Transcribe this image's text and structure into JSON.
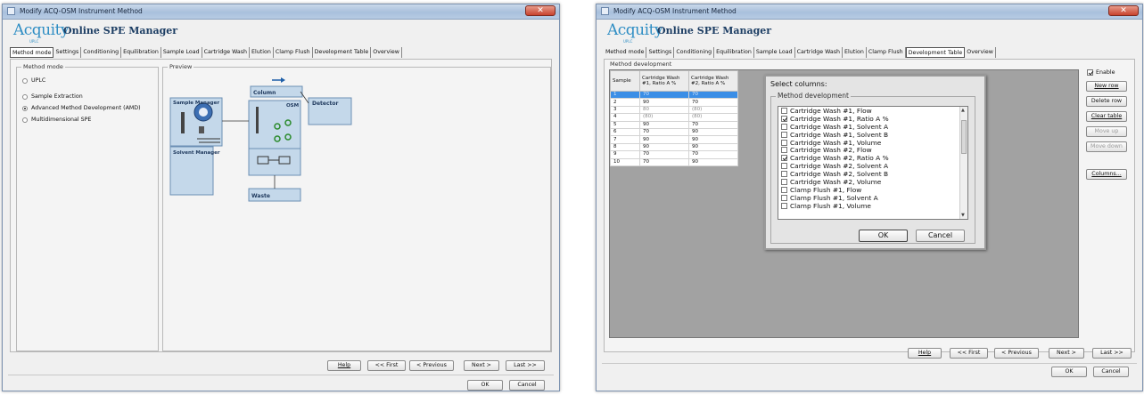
{
  "window1": {
    "title": "Modify ACQ-OSM Instrument Method",
    "close": "✕",
    "logo": "Acquity",
    "logo_sub": "UPLC",
    "app_title": "Online SPE Manager",
    "tabs": [
      "Method mode",
      "Settings",
      "Conditioning",
      "Equilibration",
      "Sample Load",
      "Cartridge Wash",
      "Elution",
      "Clamp Flush",
      "Development Table",
      "Overview"
    ],
    "active_tab": "Method mode",
    "method_mode": {
      "label": "Method mode",
      "options": [
        "UPLC",
        "Sample Extraction",
        "Advanced Method Development (AMD)",
        "Multidimensional SPE"
      ],
      "selected": "Advanced Method Development (AMD)"
    },
    "preview": {
      "label": "Preview",
      "column": "Column",
      "detector": "Detector",
      "sample_manager": "Sample Manager",
      "osm": "OSM",
      "solvent_manager": "Solvent Manager",
      "waste": "Waste"
    },
    "nav": {
      "help": "Help",
      "first": "<< First",
      "previous": "< Previous",
      "next": "Next >",
      "last": "Last >>"
    },
    "ok": "OK",
    "cancel": "Cancel"
  },
  "window2": {
    "title": "Modify ACQ-OSM Instrument Method",
    "close": "✕",
    "logo": "Acquity",
    "logo_sub": "UPLC",
    "app_title": "Online SPE Manager",
    "tabs": [
      "Method mode",
      "Settings",
      "Conditioning",
      "Equilibration",
      "Sample Load",
      "Cartridge Wash",
      "Elution",
      "Clamp Flush",
      "Development Table",
      "Overview"
    ],
    "active_tab": "Development Table",
    "group_label": "Method development",
    "table": {
      "headers": [
        "Sample",
        "Cartridge Wash #1, Ratio A %",
        "Cartridge Wash #2, Ratio A %"
      ],
      "rows": [
        [
          "1",
          "70",
          "70"
        ],
        [
          "2",
          "90",
          "70"
        ],
        [
          "3",
          "80",
          "(80)"
        ],
        [
          "4",
          "(80)",
          "(80)"
        ],
        [
          "5",
          "90",
          "70"
        ],
        [
          "6",
          "70",
          "90"
        ],
        [
          "7",
          "90",
          "90"
        ],
        [
          "8",
          "90",
          "90"
        ],
        [
          "9",
          "70",
          "70"
        ],
        [
          "10",
          "70",
          "90"
        ]
      ],
      "selected_row": 0
    },
    "enable": {
      "label": "Enable",
      "checked": true
    },
    "side_buttons": {
      "new_row": "New row",
      "delete_row": "Delete row",
      "clear_table": "Clear table",
      "move_up": "Move up",
      "move_down": "Move down",
      "columns": "Columns..."
    },
    "dialog": {
      "title": "Select columns:",
      "group_label": "Method development",
      "items": [
        {
          "label": "Cartridge Wash #1, Flow",
          "checked": false
        },
        {
          "label": "Cartridge Wash #1, Ratio A %",
          "checked": true
        },
        {
          "label": "Cartridge Wash #1, Solvent A",
          "checked": false
        },
        {
          "label": "Cartridge Wash #1, Solvent B",
          "checked": false
        },
        {
          "label": "Cartridge Wash #1, Volume",
          "checked": false
        },
        {
          "label": "Cartridge Wash #2, Flow",
          "checked": false
        },
        {
          "label": "Cartridge Wash #2, Ratio A %",
          "checked": true
        },
        {
          "label": "Cartridge Wash #2, Solvent A",
          "checked": false
        },
        {
          "label": "Cartridge Wash #2, Solvent B",
          "checked": false
        },
        {
          "label": "Cartridge Wash #2, Volume",
          "checked": false
        },
        {
          "label": "Clamp Flush #1, Flow",
          "checked": false
        },
        {
          "label": "Clamp Flush #1, Solvent A",
          "checked": false
        },
        {
          "label": "Clamp Flush #1, Volume",
          "checked": false
        }
      ],
      "ok": "OK",
      "cancel": "Cancel"
    },
    "nav": {
      "help": "Help",
      "first": "<< First",
      "previous": "< Previous",
      "next": "Next >",
      "last": "Last >>"
    },
    "ok": "OK",
    "cancel": "Cancel"
  },
  "colors": {
    "title_bar": "#b7cbe3",
    "logo_blue": "#2f8ec4",
    "diagram_box": "#c4d8ea",
    "selected_row": "#3b8ee6",
    "close_red": "#c8432e"
  }
}
